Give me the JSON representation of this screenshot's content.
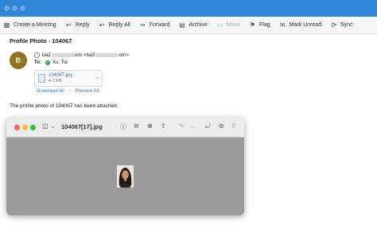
{
  "toolbar": {
    "create_meeting": "Create a Meeting",
    "reply": "Reply",
    "reply_all": "Reply All",
    "forward": "Forward",
    "archive": "Archive",
    "move": "Move",
    "flag": "Flag",
    "mark_unread": "Mark Unread",
    "sync": "Sync"
  },
  "email": {
    "subject": "Profile Photo - 104067",
    "avatar_initial": "B",
    "from_start": "ba2",
    "from_mid": "om <ba2",
    "from_end": "om>",
    "to_label": "To:",
    "to_name": "Xu, Tia",
    "body": "The profile photo of 104067 has been attached."
  },
  "attachment": {
    "name": "104067.jpg",
    "size": "4.2 KB",
    "download_all": "Download All",
    "preview_all": "Preview All"
  },
  "preview": {
    "title": "104067[17].jpg"
  },
  "colors": {
    "titlebar": "#2f86d6",
    "avatar": "#98711f",
    "link": "#2f7bd1"
  }
}
